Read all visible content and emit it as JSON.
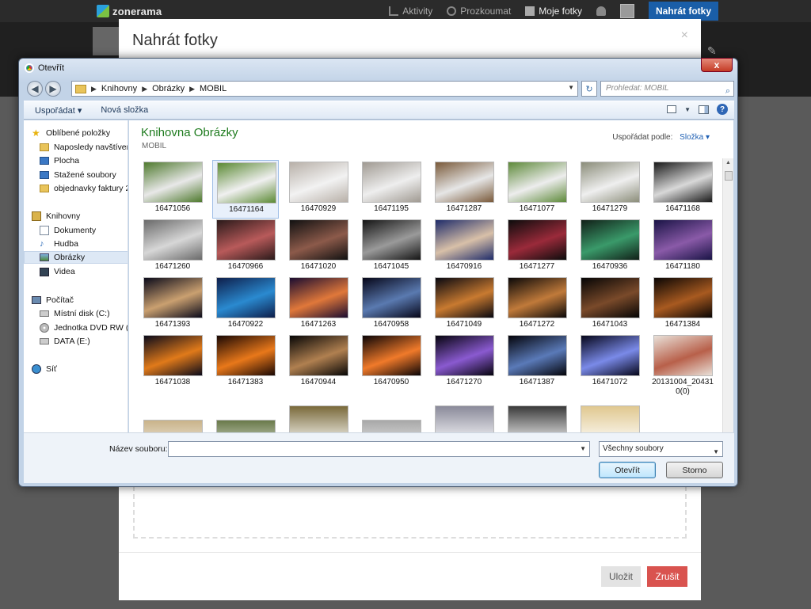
{
  "zonerama": {
    "logo": "zonerama",
    "nav": {
      "activity": "Aktivity",
      "explore": "Prozkoumat",
      "my_photos": "Moje fotky",
      "upload": "Nahrát fotky"
    },
    "modal": {
      "title": "Nahrát fotky",
      "close": "×",
      "save": "Uložit",
      "cancel": "Zrušit"
    }
  },
  "dialog": {
    "window_title": "Otevřít",
    "close": "x",
    "breadcrumb": [
      "Knihovny",
      "Obrázky",
      "MOBIL"
    ],
    "search_placeholder": "Prohledat: MOBIL",
    "toolbar": {
      "organize": "Uspořádat",
      "new_folder": "Nová složka"
    },
    "nav_pane": [
      {
        "label": "Oblíbené položky",
        "icon": "star-icon"
      },
      {
        "label": "Naposledy navštíven",
        "icon": "recent-icon"
      },
      {
        "label": "Plocha",
        "icon": "desktop-icon"
      },
      {
        "label": "Stažené soubory",
        "icon": "downloads-icon"
      },
      {
        "label": "objednavky faktury 2",
        "icon": "folder-icon"
      },
      {
        "label": "Knihovny",
        "icon": "libraries-icon"
      },
      {
        "label": "Dokumenty",
        "icon": "documents-icon"
      },
      {
        "label": "Hudba",
        "icon": "music-icon"
      },
      {
        "label": "Obrázky",
        "icon": "pictures-icon"
      },
      {
        "label": "Videa",
        "icon": "videos-icon"
      },
      {
        "label": "Počítač",
        "icon": "computer-icon"
      },
      {
        "label": "Místní disk (C:)",
        "icon": "disk-icon"
      },
      {
        "label": "Jednotka DVD RW (D",
        "icon": "dvd-icon"
      },
      {
        "label": "DATA (E:)",
        "icon": "drive-icon"
      },
      {
        "label": "Síť",
        "icon": "network-icon"
      }
    ],
    "library_title": "Knihovna Obrázky",
    "library_subtitle": "MOBIL",
    "arrange_label": "Uspořádat podle:",
    "arrange_value": "Složka",
    "files": [
      {
        "name": "16471056",
        "colors": [
          "#4f7a2e",
          "#e8e8e8"
        ]
      },
      {
        "name": "16471164",
        "colors": [
          "#5b8a34",
          "#f0f0f0"
        ]
      },
      {
        "name": "16470929",
        "colors": [
          "#b8b0a8",
          "#f2f2f2"
        ]
      },
      {
        "name": "16471195",
        "colors": [
          "#a09a92",
          "#eeeeee"
        ]
      },
      {
        "name": "16471287",
        "colors": [
          "#7a5a3a",
          "#e6e6e6"
        ]
      },
      {
        "name": "16471077",
        "colors": [
          "#5e8a3a",
          "#ededed"
        ]
      },
      {
        "name": "16471279",
        "colors": [
          "#8b8d7a",
          "#efefef"
        ]
      },
      {
        "name": "16471168",
        "colors": [
          "#1a1a1a",
          "#d8d8d8"
        ]
      },
      {
        "name": "16471260",
        "colors": [
          "#6a6a6a",
          "#d7d7d7"
        ]
      },
      {
        "name": "16470966",
        "colors": [
          "#2a1a1a",
          "#b85a5a"
        ]
      },
      {
        "name": "16471020",
        "colors": [
          "#111111",
          "#8c5a4a"
        ]
      },
      {
        "name": "16471045",
        "colors": [
          "#151515",
          "#9a9a9a"
        ]
      },
      {
        "name": "16470916",
        "colors": [
          "#1f2c6a",
          "#d8c0a8"
        ]
      },
      {
        "name": "16471277",
        "colors": [
          "#0c0c0c",
          "#9a2a3a"
        ]
      },
      {
        "name": "16470936",
        "colors": [
          "#112018",
          "#3a9a6a"
        ]
      },
      {
        "name": "16471180",
        "colors": [
          "#1a1446",
          "#8a5aa8"
        ]
      },
      {
        "name": "16471393",
        "colors": [
          "#0a0a1a",
          "#caa070"
        ]
      },
      {
        "name": "16470922",
        "colors": [
          "#0e1e4a",
          "#2a8ad0"
        ]
      },
      {
        "name": "16471263",
        "colors": [
          "#1a0c30",
          "#e0783a"
        ]
      },
      {
        "name": "16470958",
        "colors": [
          "#060618",
          "#5a7ab0"
        ]
      },
      {
        "name": "16471049",
        "colors": [
          "#080810",
          "#c87a30"
        ]
      },
      {
        "name": "16471272",
        "colors": [
          "#0a0808",
          "#c07a3a"
        ]
      },
      {
        "name": "16471043",
        "colors": [
          "#050505",
          "#7a4a2a"
        ]
      },
      {
        "name": "16471384",
        "colors": [
          "#0a0604",
          "#a85a20"
        ]
      },
      {
        "name": "16471038",
        "colors": [
          "#0a0a1a",
          "#e07a1a"
        ]
      },
      {
        "name": "16471383",
        "colors": [
          "#1a0804",
          "#e8781a"
        ]
      },
      {
        "name": "16470944",
        "colors": [
          "#060606",
          "#b08050"
        ]
      },
      {
        "name": "16470950",
        "colors": [
          "#0a0406",
          "#f07a2a"
        ]
      },
      {
        "name": "16471270",
        "colors": [
          "#06040e",
          "#8a5ad0"
        ]
      },
      {
        "name": "16471387",
        "colors": [
          "#04040a",
          "#5a7ab8"
        ]
      },
      {
        "name": "16471072",
        "colors": [
          "#06061a",
          "#7a8ae8"
        ]
      },
      {
        "name": "20131004_204310(0)",
        "colors": [
          "#e8e0d8",
          "#b8604a"
        ]
      }
    ],
    "filename_label": "Název souboru:",
    "filename_value": "",
    "filetype": "Všechny soubory",
    "open_button": "Otevřít",
    "cancel_button": "Storno"
  }
}
